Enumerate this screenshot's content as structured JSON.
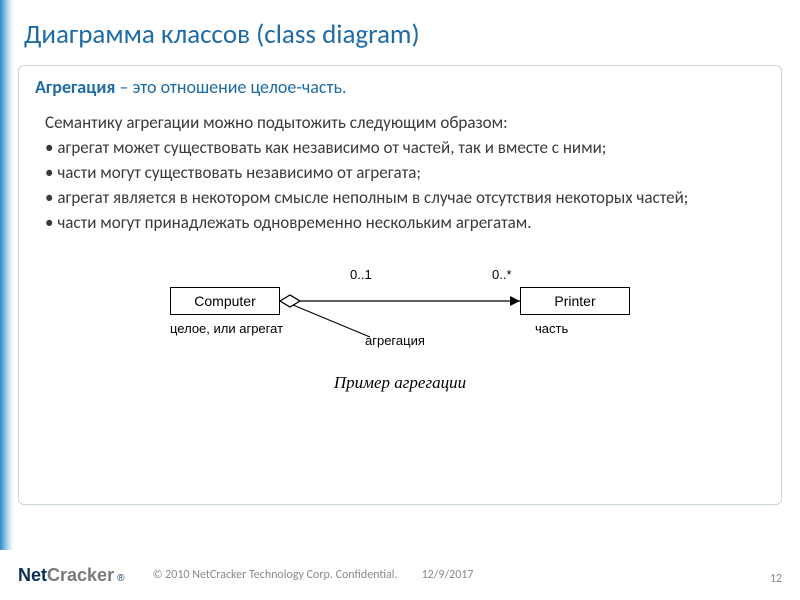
{
  "header": {
    "title": "Диаграмма классов (class diagram)"
  },
  "content": {
    "definition_term": "Агрегация",
    "definition_rest": " – это отношение целое-часть.",
    "intro": "Семантику агрегации можно подытожить следующим образом:",
    "bullets": [
      "агрегат может существовать как независимо от частей, так и вместе с ними;",
      "части могут существовать независимо от агрегата;",
      "агрегат является в некотором смысле неполным в случае отсутствия некоторых частей;",
      "части могут принадлежать одновременно нескольким агрегатам."
    ]
  },
  "diagram": {
    "class_left": "Computer",
    "class_right": "Printer",
    "mult_left": "0..1",
    "mult_right": "0..*",
    "caption_whole": "целое, или агрегат",
    "caption_part": "часть",
    "caption_relation": "агрегация",
    "title": "Пример агрегации"
  },
  "footer": {
    "logo_part1": "Net",
    "logo_part2": "Cracker",
    "logo_reg": "®",
    "copyright": "© 2010 NetCracker Technology Corp. Confidential.",
    "date": "12/9/2017",
    "page": "12"
  }
}
